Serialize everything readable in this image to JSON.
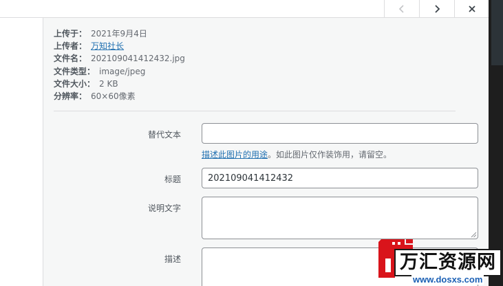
{
  "header": {
    "prev_icon": "chevron-left-icon",
    "next_icon": "chevron-right-icon",
    "close_icon": "close-icon"
  },
  "details": [
    {
      "label": "上传于：",
      "value": "2021年9月4日"
    },
    {
      "label": "上传者：",
      "value": "万知社长",
      "is_link": true
    },
    {
      "label": "文件名：",
      "value": "202109041412432.jpg"
    },
    {
      "label": "文件类型：",
      "value": "image/jpeg"
    },
    {
      "label": "文件大小：",
      "value": "2 KB"
    },
    {
      "label": "分辨率：",
      "value": "60×60像素"
    }
  ],
  "form": {
    "alt_text": {
      "label": "替代文本",
      "value": ""
    },
    "alt_help": {
      "link": "描述此图片的用途",
      "rest": "。如此图片仅作装饰用，请留空。"
    },
    "title": {
      "label": "标题",
      "value": "202109041412432"
    },
    "caption": {
      "label": "说明文字",
      "value": ""
    },
    "description": {
      "label": "描述",
      "value": ""
    }
  },
  "watermark": {
    "title": "万汇资源网",
    "url": "www.dosxs.com",
    "colors": {
      "red": "#d9141b",
      "blue": "#1a5fb4"
    }
  },
  "colors": {
    "link": "#2271b1",
    "sidebar_bg": "#f6f7f7",
    "input_border": "#8c8f94"
  }
}
